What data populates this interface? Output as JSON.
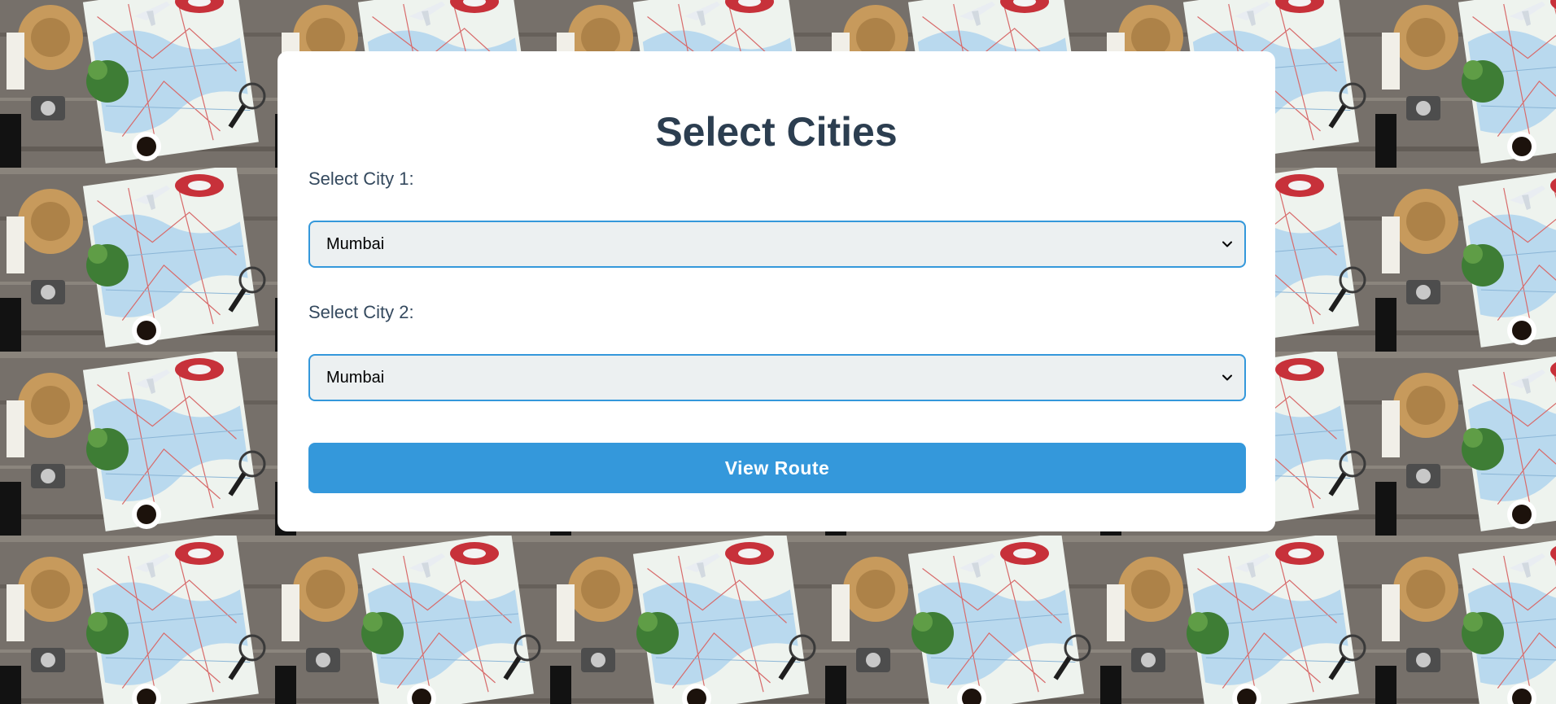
{
  "page": {
    "title": "Select Cities"
  },
  "form": {
    "city1": {
      "label": "Select City 1:",
      "selected": "Mumbai"
    },
    "city2": {
      "label": "Select City 2:",
      "selected": "Mumbai"
    },
    "submit_label": "View Route"
  },
  "icons": {
    "dropdown": "chevron-down-icon"
  },
  "colors": {
    "heading": "#2c3e50",
    "label": "#34495e",
    "accent": "#3498db",
    "select_background": "#ecf0f1",
    "card": "#ffffff"
  }
}
